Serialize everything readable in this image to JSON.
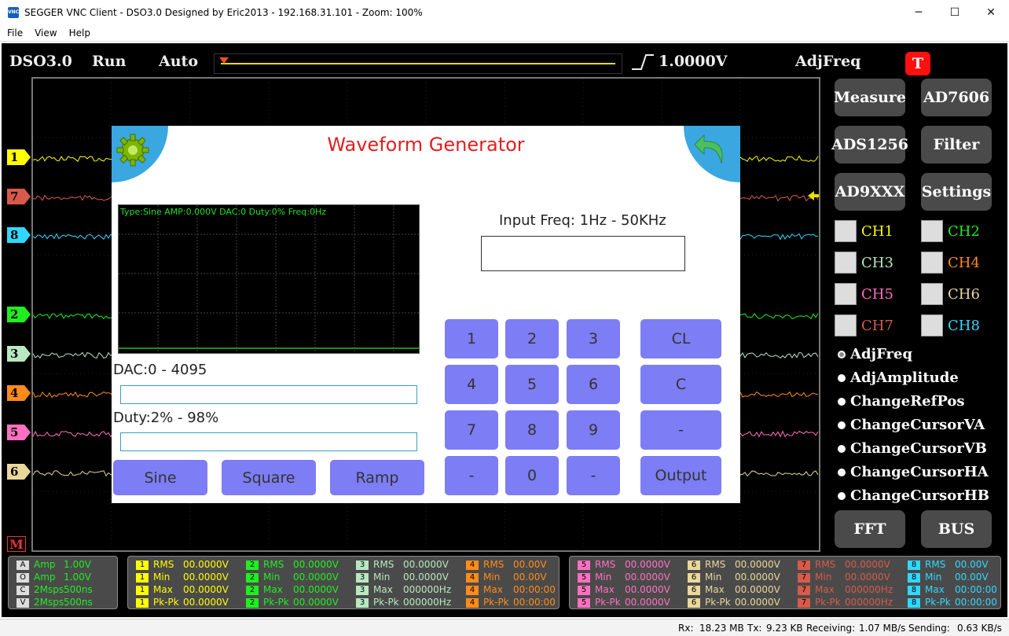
{
  "window": {
    "title": "SEGGER VNC Client - DSO3.0 Designed by Eric2013 - 192.168.31.101 - Zoom: 100%",
    "app_icon": "VNC",
    "minimize": "─",
    "maximize": "☐",
    "close": "✕"
  },
  "menu": [
    "File",
    "View",
    "Help"
  ],
  "topbar": {
    "app": "DSO3.0",
    "state": "Run",
    "mode": "Auto",
    "trigger_level": "1.0000V",
    "adj": "AdjFreq",
    "t_button": "T"
  },
  "channel_markers": [
    {
      "label": "1",
      "color": "#ffff00"
    },
    {
      "label": "7",
      "color": "#d85a4a"
    },
    {
      "label": "8",
      "color": "#30d8ff"
    },
    {
      "label": "2",
      "color": "#20ee20"
    },
    {
      "label": "3",
      "color": "#b8e8c0"
    },
    {
      "label": "4",
      "color": "#ff8c1a"
    },
    {
      "label": "5",
      "color": "#ff70c0"
    },
    {
      "label": "6",
      "color": "#e8d89a"
    }
  ],
  "m_marker": "M",
  "right_buttons": [
    "Measure",
    "AD7606",
    "ADS1256",
    "Filter",
    "AD9XXX",
    "Settings"
  ],
  "channels": [
    {
      "name": "CH1",
      "color": "#ffff00"
    },
    {
      "name": "CH2",
      "color": "#20ee20"
    },
    {
      "name": "CH3",
      "color": "#b8e8c0"
    },
    {
      "name": "CH4",
      "color": "#ff8c1a"
    },
    {
      "name": "CH5",
      "color": "#ff70c0"
    },
    {
      "name": "CH6",
      "color": "#e8d89a"
    },
    {
      "name": "CH7",
      "color": "#d85a4a"
    },
    {
      "name": "CH8",
      "color": "#30d8ff"
    }
  ],
  "adjust_options": [
    "AdjFreq",
    "AdjAmplitude",
    "ChangeRefPos",
    "ChangeCursorVA",
    "ChangeCursorVB",
    "ChangeCursorHA",
    "ChangeCursorHB"
  ],
  "bottom_buttons": [
    "FFT",
    "BUS"
  ],
  "dialog": {
    "title": "Waveform Generator",
    "settings_icon": "gear-icon",
    "back_icon": "back-arrow-icon",
    "scope_info": "Type:Sine  AMP:0.000V  DAC:0  Duty:0%  Freq:0Hz",
    "dac_label": "DAC:0 - 4095",
    "duty_label": "Duty:2% - 98%",
    "freq_label": "Input Freq: 1Hz - 50KHz",
    "dac_value": "",
    "duty_value": "",
    "freq_value": "",
    "wave_buttons": [
      "Sine",
      "Square",
      "Ramp"
    ],
    "keys": [
      "1",
      "2",
      "3",
      "CL",
      "4",
      "5",
      "6",
      "C",
      "7",
      "8",
      "9",
      "-",
      "-",
      "0",
      "-",
      "Output"
    ]
  },
  "info_panel_a": [
    {
      "badge": "A",
      "key": "Amp",
      "val": "1.00V",
      "color": "#20ee20"
    },
    {
      "badge": "O",
      "key": "Amp",
      "val": "1.00V",
      "color": "#20ee20"
    },
    {
      "badge": "C",
      "key": "2Msps",
      "val": "500ns",
      "color": "#20ee20"
    },
    {
      "badge": "V",
      "key": "2Msps",
      "val": "500ns",
      "color": "#20ee20"
    }
  ],
  "info_panel_b": [
    {
      "ch": "1",
      "color": "#ffff00",
      "rows": [
        [
          "RMS",
          "00.0000V"
        ],
        [
          "Min",
          "00.0000V"
        ],
        [
          "Max",
          "00.0000V"
        ],
        [
          "Pk-Pk",
          "00.0000V"
        ]
      ]
    },
    {
      "ch": "2",
      "color": "#20ee20",
      "rows": [
        [
          "RMS",
          "00.0000V"
        ],
        [
          "Min",
          "00.0000V"
        ],
        [
          "Max",
          "00.0000V"
        ],
        [
          "Pk-Pk",
          "00.0000V"
        ]
      ]
    },
    {
      "ch": "3",
      "color": "#b8e8c0",
      "rows": [
        [
          "RMS",
          "00.0000V"
        ],
        [
          "Min",
          "00.0000V"
        ],
        [
          "Max",
          "000000Hz"
        ],
        [
          "Pk-Pk",
          "000000Hz"
        ]
      ]
    },
    {
      "ch": "4",
      "color": "#ff8c1a",
      "rows": [
        [
          "RMS",
          "00.00V"
        ],
        [
          "Min",
          "00.00V"
        ],
        [
          "Max",
          "00:00:00"
        ],
        [
          "Pk-Pk",
          "00:00:00"
        ]
      ]
    }
  ],
  "info_panel_c": [
    {
      "ch": "5",
      "color": "#ff70c0",
      "rows": [
        [
          "RMS",
          "00.0000V"
        ],
        [
          "Min",
          "00.0000V"
        ],
        [
          "Max",
          "00.0000V"
        ],
        [
          "Pk-Pk",
          "00.0000V"
        ]
      ]
    },
    {
      "ch": "6",
      "color": "#e8d89a",
      "rows": [
        [
          "RMS",
          "00.0000V"
        ],
        [
          "Min",
          "00.0000V"
        ],
        [
          "Max",
          "00.0000V"
        ],
        [
          "Pk-Pk",
          "00.0000V"
        ]
      ]
    },
    {
      "ch": "7",
      "color": "#d85a4a",
      "rows": [
        [
          "RMS",
          "00.0000V"
        ],
        [
          "Min",
          "00.0000V"
        ],
        [
          "Max",
          "000000Hz"
        ],
        [
          "Pk-Pk",
          "000000Hz"
        ]
      ]
    },
    {
      "ch": "8",
      "color": "#30d8ff",
      "rows": [
        [
          "RMS",
          "00.00V"
        ],
        [
          "Min",
          "00.00V"
        ],
        [
          "Max",
          "00:00:00"
        ],
        [
          "Pk-Pk",
          "00:00:00"
        ]
      ]
    }
  ],
  "status": {
    "rx_label": "Rx:",
    "rx": "18.23 MB",
    "tx_label": "Tx:",
    "tx": "9.23 KB",
    "recv_label": "Receiving:",
    "recv": "1.07 MB/s",
    "send_label": "Sending:",
    "send": "0.63 KB/s"
  }
}
